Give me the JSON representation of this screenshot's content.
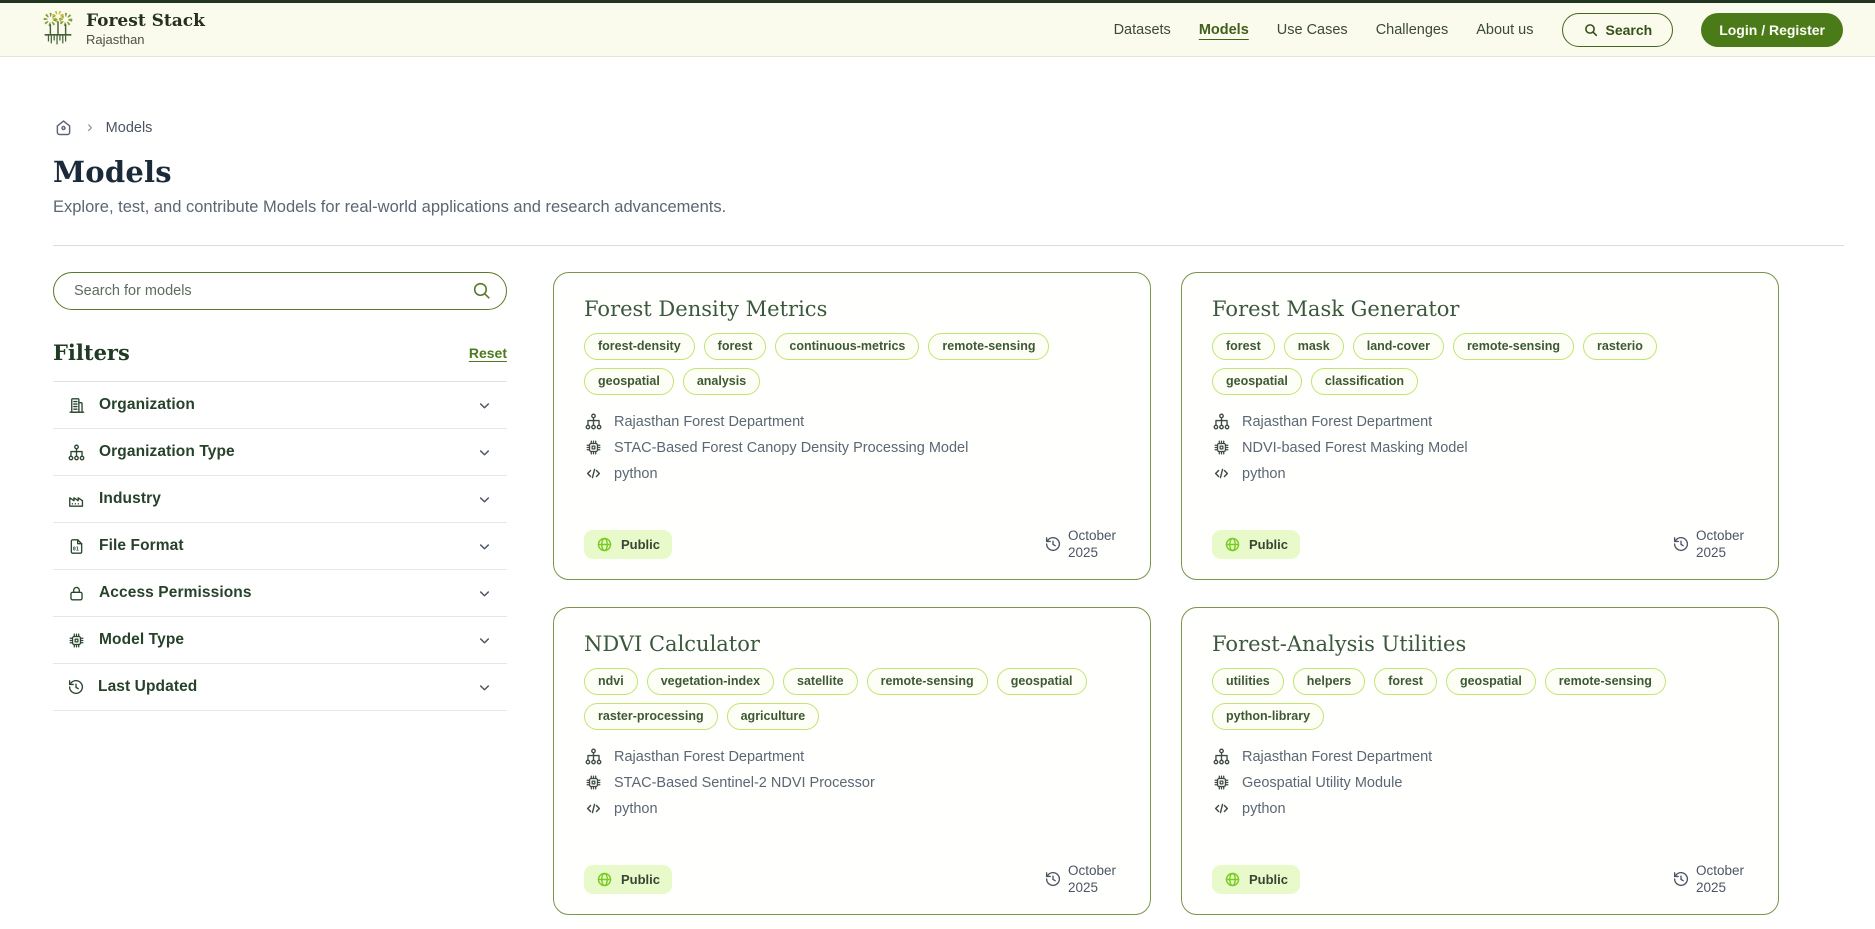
{
  "theme": {
    "accent_green": "#4c7a1d",
    "header_bg": "#fafbec",
    "card_border": "#78954a",
    "tag_border": "#c1e472",
    "badge_bg": "#e8fac9",
    "badge_globe": "#79ca24",
    "title_navy": "#1b2a3a",
    "heading_green": "#203a23"
  },
  "header": {
    "brand": {
      "title": "Forest Stack",
      "subtitle": "Rajasthan"
    },
    "nav": [
      {
        "label": "Datasets",
        "active": false
      },
      {
        "label": "Models",
        "active": true
      },
      {
        "label": "Use Cases",
        "active": false
      },
      {
        "label": "Challenges",
        "active": false
      },
      {
        "label": "About us",
        "active": false
      }
    ],
    "search_label": "Search",
    "login_label": "Login / Register"
  },
  "breadcrumb": {
    "current": "Models"
  },
  "page": {
    "title": "Models",
    "subtitle": "Explore, test, and contribute Models for real-world applications and research advancements."
  },
  "sidebar": {
    "search_placeholder": "Search for models",
    "filters_title": "Filters",
    "reset_label": "Reset",
    "filters": [
      {
        "label": "Organization",
        "icon": "building-icon"
      },
      {
        "label": "Organization Type",
        "icon": "org-chart-icon"
      },
      {
        "label": "Industry",
        "icon": "factory-icon"
      },
      {
        "label": "File Format",
        "icon": "file-format-icon"
      },
      {
        "label": "Access Permissions",
        "icon": "lock-icon"
      },
      {
        "label": "Model Type",
        "icon": "chip-icon"
      },
      {
        "label": "Last Updated",
        "icon": "history-icon"
      }
    ]
  },
  "cards": [
    {
      "title": "Forest Density Metrics",
      "tags": [
        "forest-density",
        "forest",
        "continuous-metrics",
        "remote-sensing",
        "geospatial",
        "analysis"
      ],
      "organization": "Rajasthan Forest Department",
      "description": "STAC-Based Forest Canopy Density Processing Model",
      "language": "python",
      "visibility": "Public",
      "updated": "October 2025"
    },
    {
      "title": "Forest Mask Generator",
      "tags": [
        "forest",
        "mask",
        "land-cover",
        "remote-sensing",
        "rasterio",
        "geospatial",
        "classification"
      ],
      "organization": "Rajasthan Forest Department",
      "description": "NDVI-based Forest Masking Model",
      "language": "python",
      "visibility": "Public",
      "updated": "October 2025"
    },
    {
      "title": "NDVI Calculator",
      "tags": [
        "ndvi",
        "vegetation-index",
        "satellite",
        "remote-sensing",
        "geospatial",
        "raster-processing",
        "agriculture"
      ],
      "organization": "Rajasthan Forest Department",
      "description": "STAC-Based Sentinel-2 NDVI Processor",
      "language": "python",
      "visibility": "Public",
      "updated": "October 2025"
    },
    {
      "title": "Forest-Analysis Utilities",
      "tags": [
        "utilities",
        "helpers",
        "forest",
        "geospatial",
        "remote-sensing",
        "python-library"
      ],
      "organization": "Rajasthan Forest Department",
      "description": "Geospatial Utility Module",
      "language": "python",
      "visibility": "Public",
      "updated": "October 2025"
    }
  ],
  "icons": {
    "forest-stack-logo": "dotted trees with roots",
    "search-icon": "magnifier",
    "home-icon": "rounded house with dot",
    "chevron-right-icon": "›",
    "chevron-down-icon": "v",
    "building-icon": "office building",
    "org-chart-icon": "hierarchy nodes",
    "factory-icon": "industry plant",
    "file-format-icon": "document with 01",
    "lock-icon": "padlock",
    "chip-icon": "cpu chip",
    "history-icon": "clock with back arrow",
    "code-icon": "</>",
    "globe-icon": "green globe"
  }
}
